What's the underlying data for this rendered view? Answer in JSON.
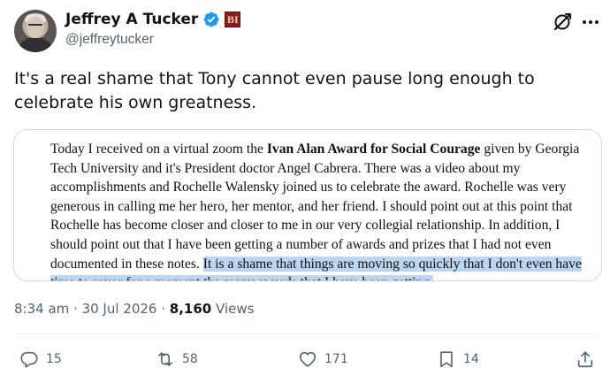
{
  "author": {
    "display_name": "Jeffrey A Tucker",
    "handle": "@jeffreytucker",
    "affiliation_badge": "BI"
  },
  "tweet": {
    "text": "It's a real shame that Tony cannot even pause long enough to celebrate his own greatness."
  },
  "document": {
    "intro": "Today I received on a virtual zoom the ",
    "award_name": "Ivan Alan Award for Social Courage",
    "body": " given by Georgia Tech University and it's President doctor Angel Cabrera. There was a video about my accomplishments and Rochelle Walensky joined us to celebrate the award. Rochelle was very generous in calling me her hero, her mentor, and her friend. I should point out at this point that Rochelle has become closer and closer to me in our very collegial relationship. In addition, I should point out that I have been getting a number of awards and prizes that I had not even documented in these notes. ",
    "highlighted": "It is a shame that things are moving so quickly that I don't even have time to savor for a moment the many awards that I have been getting."
  },
  "meta": {
    "time": "8:34 am",
    "separator": " · ",
    "date": "30 Jul 2026",
    "views_count": "8,160",
    "views_label": " Views"
  },
  "actions": {
    "replies": "15",
    "reposts": "58",
    "likes": "171",
    "bookmarks": "14"
  },
  "colors": {
    "verified": "#1d9bf0",
    "secondary_text": "#536471",
    "highlight": "#bcd5f0",
    "affiliation_badge_bg": "#8a1d1d"
  },
  "icons": [
    "verified-badge-icon",
    "grok-icon",
    "more-icon",
    "reply-icon",
    "repost-icon",
    "like-icon",
    "bookmark-icon",
    "share-icon"
  ]
}
